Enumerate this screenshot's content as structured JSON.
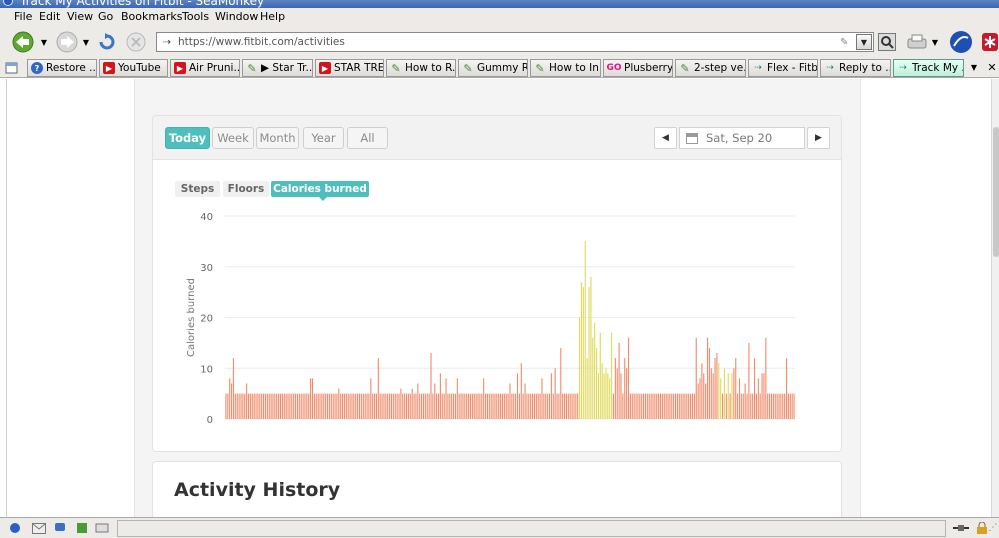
{
  "window": {
    "title": "Track My Activities on Fitbit - SeaMonkey"
  },
  "menu": [
    "File",
    "Edit",
    "View",
    "Go",
    "Bookmarks",
    "Tools",
    "Window",
    "Help"
  ],
  "address": {
    "url": "https://www.fitbit.com/activities"
  },
  "tabs": [
    {
      "label": "Restore ...",
      "icon": "question-icon"
    },
    {
      "label": "YouTube",
      "icon": "youtube-icon"
    },
    {
      "label": "Air Pruni...",
      "icon": "youtube-icon"
    },
    {
      "label": "▶ Star Tr...",
      "icon": "pin-icon"
    },
    {
      "label": "STAR TRE...",
      "icon": "youtube-icon"
    },
    {
      "label": "How to R...",
      "icon": "pin-icon"
    },
    {
      "label": "Gummy R...",
      "icon": "pin-icon"
    },
    {
      "label": "How to In...",
      "icon": "pin-icon"
    },
    {
      "label": "Plusberry...",
      "icon": "go-icon"
    },
    {
      "label": "2-step ve...",
      "icon": "pin-icon"
    },
    {
      "label": "Flex - Fitb...",
      "icon": "fitbit-icon"
    },
    {
      "label": "Reply to ...",
      "icon": "fitbit-icon"
    },
    {
      "label": "Track My ...",
      "icon": "fitbit-icon"
    }
  ],
  "dashboard": {
    "ranges": [
      "Today",
      "Week",
      "Month",
      "Year",
      "All"
    ],
    "active_range": "Today",
    "date": "Sat, Sep 20",
    "metrics": [
      "Steps",
      "Floors",
      "Calories burned"
    ],
    "active_metric": "Calories burned",
    "history_title": "Activity History"
  },
  "chart_data": {
    "type": "bar",
    "ylabel": "Calories burned",
    "xlabel": "",
    "ylim": [
      0,
      40
    ],
    "yticks": [
      0,
      10,
      20,
      30,
      40
    ],
    "grid": true,
    "legend": "none",
    "interval": "minute-level bars across the day",
    "base_color": "#f08c6c",
    "active_color": "#e0db5c",
    "values": [
      5,
      5,
      8,
      7,
      12,
      5,
      5,
      5,
      5,
      5,
      5,
      7,
      5,
      5,
      5,
      5,
      5,
      5,
      5,
      5,
      5,
      5,
      5,
      5,
      5,
      5,
      5,
      5,
      5,
      5,
      5,
      5,
      5,
      5,
      5,
      5,
      5,
      5,
      5,
      5,
      5,
      5,
      5,
      5,
      5,
      8,
      8,
      5,
      5,
      5,
      5,
      5,
      5,
      5,
      5,
      5,
      5,
      5,
      5,
      5,
      6,
      5,
      5,
      5,
      5,
      5,
      5,
      5,
      5,
      5,
      5,
      5,
      5,
      5,
      5,
      5,
      5,
      8,
      5,
      5,
      5,
      12,
      5,
      5,
      5,
      5,
      5,
      5,
      5,
      5,
      5,
      5,
      5,
      6,
      5,
      5,
      5,
      5,
      5,
      6,
      5,
      5,
      7,
      5,
      5,
      5,
      5,
      5,
      5,
      13,
      5,
      7,
      5,
      5,
      9,
      5,
      5,
      8,
      5,
      5,
      5,
      5,
      5,
      8,
      5,
      5,
      5,
      5,
      5,
      5,
      5,
      5,
      5,
      5,
      5,
      5,
      5,
      8,
      5,
      5,
      5,
      5,
      5,
      5,
      5,
      5,
      5,
      5,
      5,
      5,
      5,
      7,
      5,
      5,
      5,
      9,
      5,
      11,
      5,
      7,
      5,
      5,
      5,
      5,
      5,
      5,
      5,
      5,
      8,
      5,
      5,
      5,
      5,
      9,
      5,
      10,
      5,
      5,
      14,
      5,
      5,
      5,
      5,
      5,
      5,
      5,
      5,
      5,
      20,
      27,
      26,
      35,
      12,
      26,
      28,
      16,
      19,
      14,
      9,
      17,
      11,
      9,
      10,
      9,
      8,
      17,
      5,
      12,
      10,
      15,
      9,
      5,
      12,
      10,
      16,
      5,
      5,
      5,
      5,
      5,
      5,
      5,
      5,
      5,
      5,
      5,
      5,
      5,
      5,
      5,
      5,
      5,
      5,
      5,
      5,
      5,
      5,
      5,
      5,
      5,
      5,
      5,
      5,
      5,
      5,
      5,
      5,
      5,
      5,
      5,
      16,
      7,
      8,
      11,
      9,
      7,
      16,
      14,
      10,
      9,
      12,
      13,
      11,
      8,
      5,
      10,
      5,
      9,
      5,
      9,
      10,
      12,
      5,
      8,
      5,
      5,
      7,
      5,
      15,
      5,
      5,
      12,
      5,
      8,
      5,
      9,
      9,
      16,
      5,
      5,
      5,
      5,
      5,
      5,
      5,
      5,
      5,
      5,
      12,
      5,
      5,
      5,
      5
    ],
    "active_ranges": [
      [
        179,
        206
      ],
      [
        236,
        246
      ],
      [
        262,
        269
      ]
    ]
  }
}
